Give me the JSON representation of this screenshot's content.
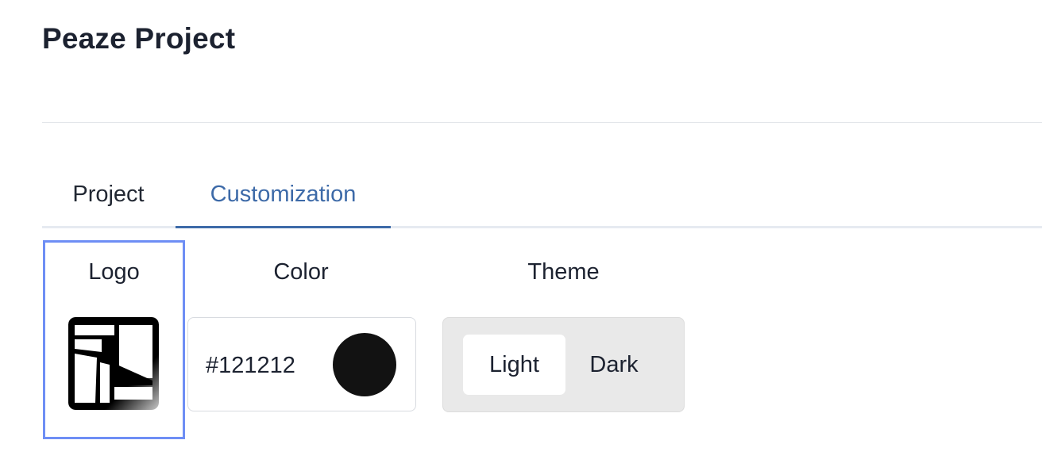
{
  "header": {
    "title": "Peaze Project"
  },
  "tabs": [
    {
      "label": "Project",
      "active": false
    },
    {
      "label": "Customization",
      "active": true
    }
  ],
  "customization": {
    "logo": {
      "label": "Logo"
    },
    "color": {
      "label": "Color",
      "value": "#121212",
      "swatch": "#121212"
    },
    "theme": {
      "label": "Theme",
      "options": [
        "Light",
        "Dark"
      ],
      "selected": "Light"
    }
  },
  "colors": {
    "accent": "#3d6aa8",
    "focus_outline": "#6e8ef5",
    "text": "#1c2230"
  }
}
